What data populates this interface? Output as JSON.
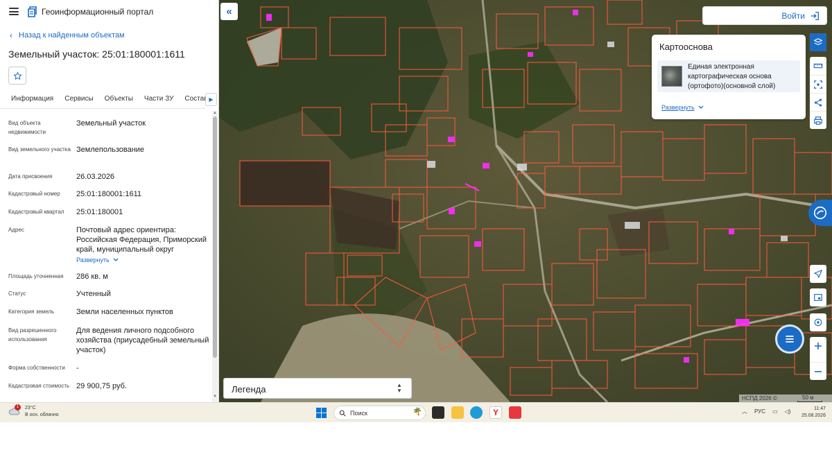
{
  "app": {
    "title": "Геоинформационный портал",
    "menu_icon": "hamburger-icon",
    "logo_icon": "portal-logo-icon"
  },
  "nav": {
    "back_label": "Назад к найденным объектам"
  },
  "object": {
    "title": "Земельный участок: 25:01:180001:1611"
  },
  "tabs": [
    {
      "label": "Информация",
      "active": true
    },
    {
      "label": "Сервисы"
    },
    {
      "label": "Объекты"
    },
    {
      "label": "Части ЗУ"
    },
    {
      "label": "Состав"
    }
  ],
  "fields": [
    {
      "label": "Вид объекта недвижимости",
      "value": "Земельный участок"
    },
    {
      "label": "Вид земельного участка",
      "value": "Землепользование"
    },
    {
      "label": "Дата присвоения",
      "value": "26.03.2026"
    },
    {
      "label": "Кадастровый номер",
      "value": "25:01:180001:1611"
    },
    {
      "label": "Кадастровый квартал",
      "value": "25:01:180001"
    },
    {
      "label": "Адрес",
      "value": "Почтовый адрес ориентира: Российская Федерация, Приморский край, муниципальный округ",
      "expand": "Развернуть"
    },
    {
      "label": "Площадь уточненная",
      "value": "286 кв. м"
    },
    {
      "label": "Статус",
      "value": "Учтенный"
    },
    {
      "label": "Категория земель",
      "value": "Земли населенных пунктов"
    },
    {
      "label": "Вид разрешенного использования",
      "value": "Для ведения личного подсобного хозяйства (приусадебный земельный участок)"
    },
    {
      "label": "Форма собственности",
      "value": "-"
    },
    {
      "label": "Кадастровая стоимость",
      "value": "29 900,75 руб."
    }
  ],
  "map": {
    "login_label": "Войти",
    "basemap": {
      "title": "Картооснова",
      "layer": "Единая электронная картографическая основа (ортофото)(основной слой)",
      "expand": "Развернуть"
    },
    "legend_label": "Легенда",
    "attribution": "НСПД 2026 ©",
    "scale": "50 м",
    "colors": {
      "parcel": "#ff5a3c",
      "highlight": "#ff2bff",
      "accent": "#1c6bc4"
    }
  },
  "taskbar": {
    "temperature": "23°C",
    "weather": "В осн. облачно",
    "notification_count": "1",
    "search_placeholder": "Поиск",
    "language": "РУС",
    "time": "11:47",
    "date": "25.08.2026"
  }
}
